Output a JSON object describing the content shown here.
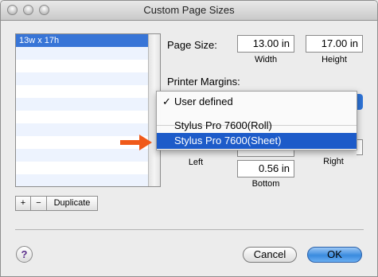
{
  "window": {
    "title": "Custom Page Sizes"
  },
  "list": {
    "items": [
      "13w x 17h"
    ]
  },
  "list_buttons": {
    "add": "+",
    "remove": "−",
    "duplicate": "Duplicate"
  },
  "page_size": {
    "label": "Page Size:",
    "width_value": "13.00 in",
    "height_value": "17.00 in",
    "width_caption": "Width",
    "height_caption": "Height"
  },
  "margins": {
    "label": "Printer Margins:",
    "left_caption": "Left",
    "right_caption": "Right",
    "bottom_caption": "Bottom",
    "bottom_value": "0.56 in"
  },
  "popup_menu": {
    "check": "✓",
    "items": [
      "User defined",
      "Stylus Pro 7600(Roll)",
      "Stylus Pro 7600(Sheet)"
    ],
    "selected_index": 0,
    "highlighted_index": 2
  },
  "footer": {
    "help": "?",
    "cancel": "Cancel",
    "ok": "OK"
  },
  "colors": {
    "arrow": "#f05a1a",
    "highlight": "#1d5bc9",
    "list_selection": "#3875d7"
  }
}
